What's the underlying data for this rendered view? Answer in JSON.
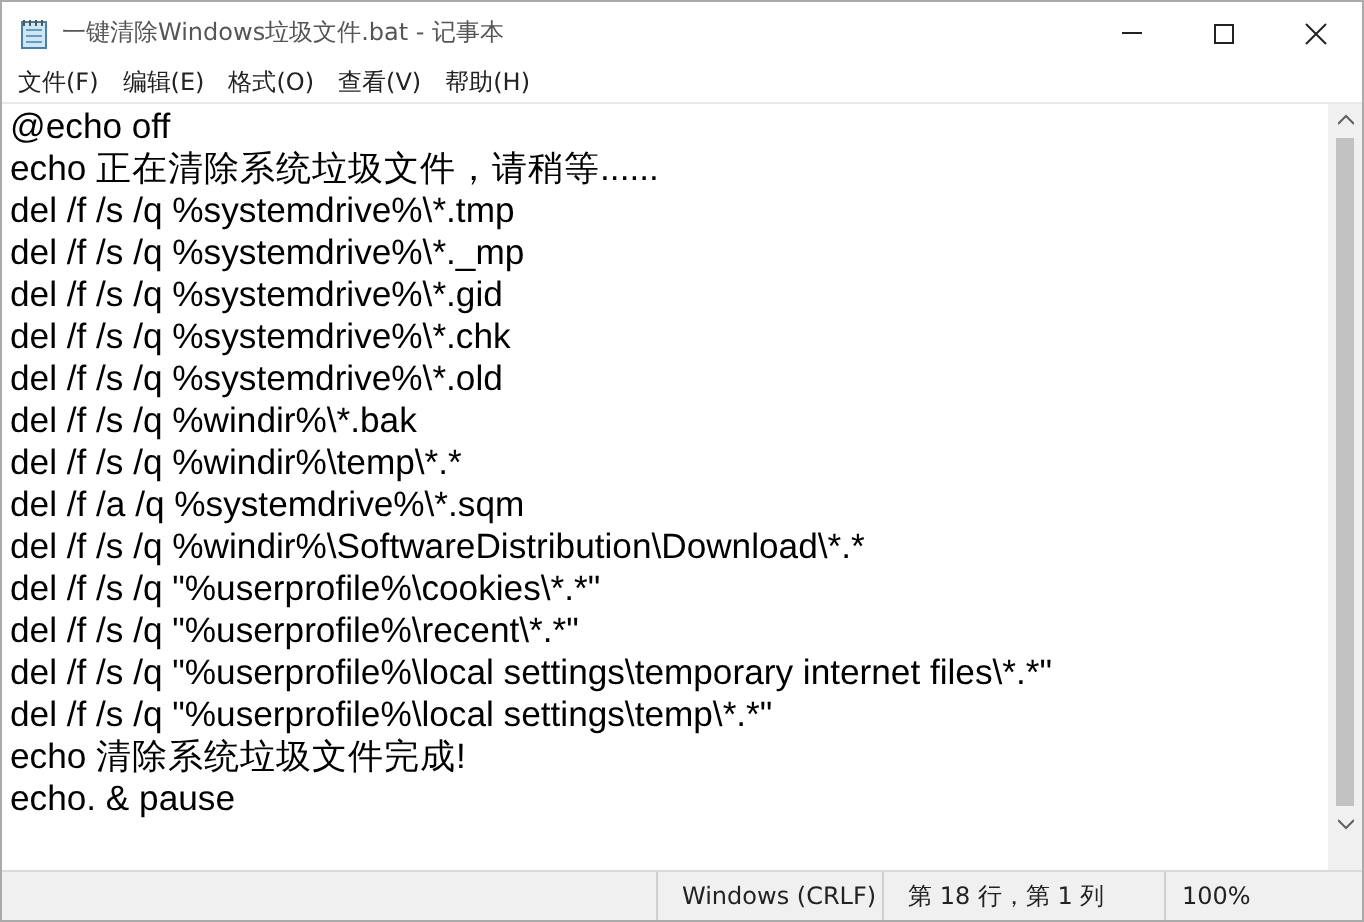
{
  "window": {
    "title": "一键清除Windows垃圾文件.bat - 记事本"
  },
  "menu": [
    "文件(F)",
    "编辑(E)",
    "格式(O)",
    "查看(V)",
    "帮助(H)"
  ],
  "editor": {
    "lines": [
      "@echo off",
      "echo 正在清除系统垃圾文件，请稍等......",
      "del /f /s /q %systemdrive%\\*.tmp",
      "del /f /s /q %systemdrive%\\*._mp",
      "del /f /s /q %systemdrive%\\*.gid",
      "del /f /s /q %systemdrive%\\*.chk",
      "del /f /s /q %systemdrive%\\*.old",
      "del /f /s /q %windir%\\*.bak",
      "del /f /s /q %windir%\\temp\\*.*",
      "del /f /a /q %systemdrive%\\*.sqm",
      "del /f /s /q %windir%\\SoftwareDistribution\\Download\\*.*",
      "del /f /s /q \"%userprofile%\\cookies\\*.*\"",
      "del /f /s /q \"%userprofile%\\recent\\*.*\"",
      "del /f /s /q \"%userprofile%\\local settings\\temporary internet files\\*.*\"",
      "del /f /s /q \"%userprofile%\\local settings\\temp\\*.*\"",
      "echo 清除系统垃圾文件完成!",
      "echo. & pause"
    ]
  },
  "status_bar": {
    "line_ending": "Windows (CRLF)",
    "position": "第 18 行，第 1 列",
    "zoom": "100%"
  }
}
